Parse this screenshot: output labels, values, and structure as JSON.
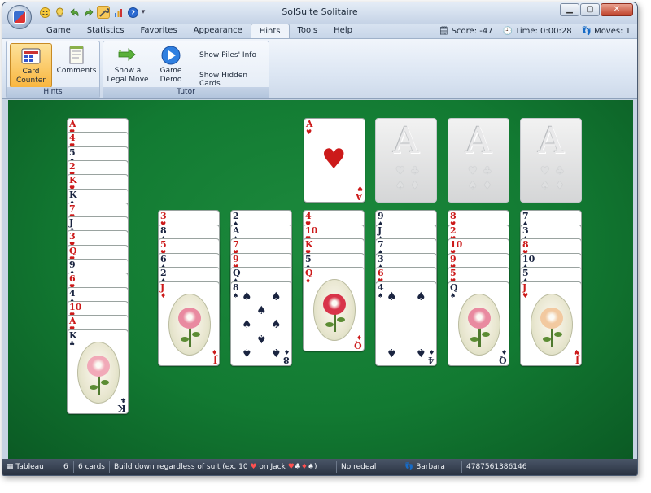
{
  "window": {
    "title": "SolSuite Solitaire"
  },
  "quick_access": [
    "smiley-icon",
    "bulb-icon",
    "undo-icon",
    "redo-icon",
    "tools-icon",
    "stats-icon",
    "help-icon"
  ],
  "menu": {
    "items": [
      "Game",
      "Statistics",
      "Favorites",
      "Appearance",
      "Hints",
      "Tools",
      "Help"
    ],
    "active": "Hints"
  },
  "stats": {
    "score": "Score: -47",
    "time": "Time: 0:00:28",
    "moves": "Moves: 1"
  },
  "ribbon": {
    "hints_group": {
      "label": "Hints",
      "card_counter": "Card\nCounter",
      "comments": "Comments"
    },
    "tutor_group": {
      "label": "Tutor",
      "legal_move": "Show a\nLegal Move",
      "demo": "Game\nDemo",
      "piles_info": "Show Piles' Info",
      "hidden_cards": "Show Hidden Cards"
    }
  },
  "status": {
    "area": "Tableau",
    "pile_no": "6",
    "card_count": "6 cards",
    "rule_pre": "Build down regardless of suit (ex. 10",
    "rule_mid": " on Jack ",
    "rule_post": ")",
    "redeal": "No redeal",
    "player": "Barbara",
    "game_no": "4787561386146"
  },
  "foundations": [
    {
      "rank": "A",
      "suit": "♥",
      "color": "#cc1a1a"
    },
    {
      "rank": "A",
      "suit": "",
      "color": ""
    },
    {
      "rank": "A",
      "suit": "",
      "color": ""
    },
    {
      "rank": "A",
      "suit": "",
      "color": ""
    }
  ],
  "tableau": [
    {
      "cards": [
        [
          "A",
          "♥"
        ],
        [
          "4",
          "♥"
        ],
        [
          "5",
          "♠"
        ],
        [
          "2",
          "♥"
        ],
        [
          "K",
          "♥"
        ],
        [
          "K",
          "♠"
        ],
        [
          "7",
          "♥"
        ],
        [
          "J",
          "♣"
        ],
        [
          "3",
          "♥"
        ],
        [
          "Q",
          "♥"
        ],
        [
          "9",
          "♠"
        ],
        [
          "6",
          "♥"
        ],
        [
          "4",
          "♠"
        ],
        [
          "10",
          "♥"
        ],
        [
          "A",
          "♥"
        ],
        [
          "K",
          "♣"
        ]
      ]
    },
    {
      "cards": [
        [
          "3",
          "♥"
        ],
        [
          "8",
          "♠"
        ],
        [
          "5",
          "♥"
        ],
        [
          "6",
          "♠"
        ],
        [
          "2",
          "♠"
        ],
        [
          "J",
          "♦"
        ]
      ]
    },
    {
      "cards": [
        [
          "2",
          "♠"
        ],
        [
          "A",
          "♠"
        ],
        [
          "7",
          "♥"
        ],
        [
          "9",
          "♥"
        ],
        [
          "Q",
          "♠"
        ],
        [
          "8",
          "♠"
        ]
      ]
    },
    {
      "cards": [
        [
          "4",
          "♥"
        ],
        [
          "10",
          "♥"
        ],
        [
          "K",
          "♥"
        ],
        [
          "5",
          "♠"
        ],
        [
          "Q",
          "♦"
        ]
      ]
    },
    {
      "cards": [
        [
          "9",
          "♠"
        ],
        [
          "J",
          "♠"
        ],
        [
          "7",
          "♠"
        ],
        [
          "3",
          "♠"
        ],
        [
          "6",
          "♥"
        ],
        [
          "4",
          "♠"
        ]
      ]
    },
    {
      "cards": [
        [
          "8",
          "♥"
        ],
        [
          "2",
          "♥"
        ],
        [
          "10",
          "♥"
        ],
        [
          "9",
          "♥"
        ],
        [
          "5",
          "♥"
        ],
        [
          "Q",
          "♠"
        ]
      ]
    },
    {
      "cards": [
        [
          "7",
          "♠"
        ],
        [
          "3",
          "♠"
        ],
        [
          "8",
          "♥"
        ],
        [
          "10",
          "♠"
        ],
        [
          "5",
          "♠"
        ],
        [
          "J",
          "♥"
        ]
      ]
    }
  ]
}
